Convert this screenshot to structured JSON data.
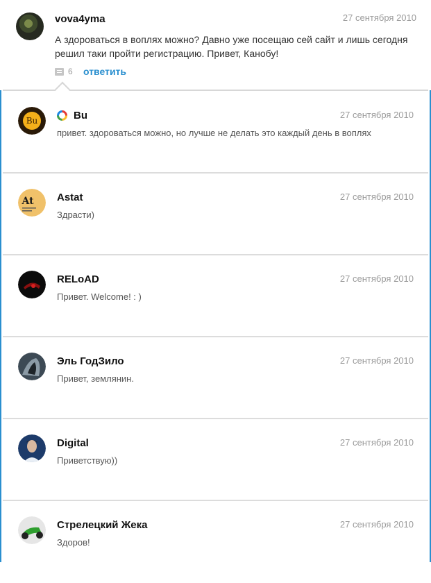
{
  "main_comment": {
    "username": "vova4yma",
    "date": "27 сентября 2010",
    "text": "А здороваться в воплях можно? Давно уже посещаю сей сайт и лишь сегодня решил таки пройти регистрацию. Привет, Канобу!",
    "reply_count": "6",
    "reply_label": "ответить"
  },
  "replies": [
    {
      "username": "Bu",
      "date": "27 сентября 2010",
      "text": "привет. здороваться можно, но лучше не делать это каждый день в воплях",
      "avatar_text": "Bu"
    },
    {
      "username": "Astat",
      "date": "27 сентября 2010",
      "text": "Здрасти)",
      "avatar_text": "At"
    },
    {
      "username": "RELoAD",
      "date": "27 сентября 2010",
      "text": "Привет. Welcome! : )"
    },
    {
      "username": "Эль ГодЗило",
      "date": "27 сентября 2010",
      "text": "Привет, землянин."
    },
    {
      "username": "Digital",
      "date": "27 сентября 2010",
      "text": "Приветствую))"
    },
    {
      "username": "Стрелецкий Жека",
      "date": "27 сентября 2010",
      "text": "Здоров!"
    }
  ],
  "colors": {
    "accent": "#2a8fcf",
    "date": "#9a9a9a",
    "divider": "#dcdcdc"
  },
  "icons": {
    "comment_count": "comment-icon",
    "verified_ring": "ring-icon"
  }
}
